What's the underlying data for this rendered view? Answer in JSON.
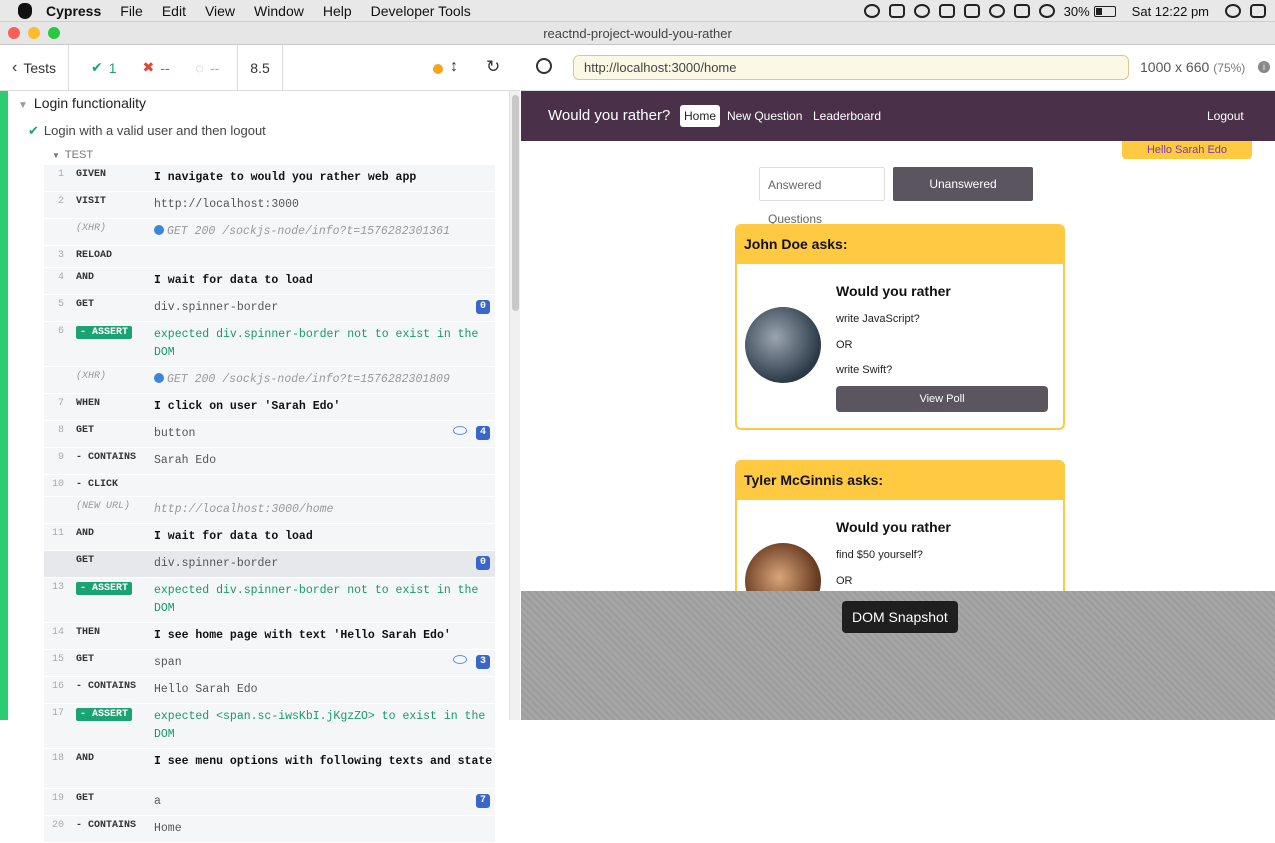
{
  "menubar": {
    "app": "Cypress",
    "items": [
      "File",
      "Edit",
      "View",
      "Window",
      "Help",
      "Developer Tools"
    ],
    "battery": "30%",
    "clock": "Sat 12:22 pm"
  },
  "window": {
    "title": "reactnd-project-would-you-rather"
  },
  "reporter": {
    "tests_label": "Tests",
    "passed": "1",
    "failed": "--",
    "pending": "--",
    "duration": "8.5",
    "suite": "Login functionality",
    "test": "Login with a valid user and then logout",
    "test_label": "TEST",
    "commands": [
      {
        "n": "1",
        "name": "GIVEN",
        "msg": "I navigate to would you rather web app",
        "kind": "bold"
      },
      {
        "n": "2",
        "name": "VISIT",
        "msg": "http://localhost:3000",
        "kind": ""
      },
      {
        "n": "",
        "name": "(XHR)",
        "msg": "GET 200 /sockjs-node/info?t=1576282301361",
        "kind": "xhr"
      },
      {
        "n": "3",
        "name": "RELOAD",
        "msg": "",
        "kind": ""
      },
      {
        "n": "4",
        "name": "AND",
        "msg": "I wait for data to load",
        "kind": "bold"
      },
      {
        "n": "5",
        "name": "GET",
        "msg": "div.spinner-border",
        "kind": "",
        "badge": "0"
      },
      {
        "n": "6",
        "name": "- ASSERT",
        "msg": "expected div.spinner-border not to exist in the DOM",
        "kind": "assert"
      },
      {
        "n": "",
        "name": "(XHR)",
        "msg": "GET 200 /sockjs-node/info?t=1576282301809",
        "kind": "xhr"
      },
      {
        "n": "7",
        "name": "WHEN",
        "msg": "I click on user 'Sarah Edo'",
        "kind": "bold"
      },
      {
        "n": "8",
        "name": "GET",
        "msg": "button",
        "kind": "",
        "badge": "4",
        "eye": true
      },
      {
        "n": "9",
        "name": "- CONTAINS",
        "msg": "Sarah Edo",
        "kind": ""
      },
      {
        "n": "10",
        "name": "- CLICK",
        "msg": "",
        "kind": ""
      },
      {
        "n": "",
        "name": "(NEW URL)",
        "msg": "http://localhost:3000/home",
        "kind": "xhr"
      },
      {
        "n": "11",
        "name": "AND",
        "msg": "I wait for data to load",
        "kind": "bold"
      },
      {
        "n": "",
        "name": "GET",
        "msg": "div.spinner-border",
        "kind": "pinned",
        "badge": "0"
      },
      {
        "n": "13",
        "name": "- ASSERT",
        "msg": "expected div.spinner-border not to exist in the DOM",
        "kind": "assert"
      },
      {
        "n": "14",
        "name": "THEN",
        "msg": "I see home page with text 'Hello Sarah Edo'",
        "kind": "bold"
      },
      {
        "n": "15",
        "name": "GET",
        "msg": "span",
        "kind": "",
        "badge": "3",
        "eye": true
      },
      {
        "n": "16",
        "name": "- CONTAINS",
        "msg": "Hello Sarah Edo",
        "kind": ""
      },
      {
        "n": "17",
        "name": "- ASSERT",
        "msg": "expected <span.sc-iwsKbI.jKgzZO> to exist in the DOM",
        "kind": "assert"
      },
      {
        "n": "18",
        "name": "AND",
        "msg": "I see menu options with following texts and state",
        "kind": "bold"
      },
      {
        "n": "19",
        "name": "GET",
        "msg": "a",
        "kind": "",
        "badge": "7"
      },
      {
        "n": "20",
        "name": "- CONTAINS",
        "msg": "Home",
        "kind": ""
      }
    ]
  },
  "browser": {
    "url": "http://localhost:3000/home",
    "size": "1000 x 660",
    "zoom": "(75%)"
  },
  "app": {
    "brand": "Would you rather?",
    "nav": [
      "Home",
      "New Question",
      "Leaderboard"
    ],
    "logout": "Logout",
    "hello": "Hello Sarah Edo",
    "tab_answered": "Answered Questions",
    "tab_unanswered": "Unanswered Questions",
    "questions": [
      {
        "author": "John Doe asks:",
        "title": "Would you rather",
        "a": "write JavaScript?",
        "or": "OR",
        "b": "write Swift?",
        "button": "View Poll"
      },
      {
        "author": "Tyler McGinnis asks:",
        "title": "Would you rather",
        "a": "find $50 yourself?",
        "or": "OR"
      }
    ]
  },
  "snapshot_label": "DOM Snapshot"
}
